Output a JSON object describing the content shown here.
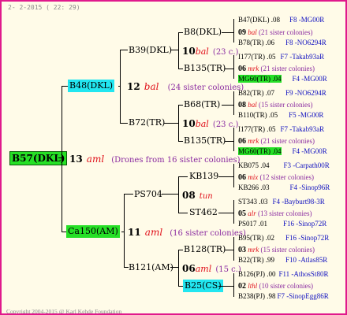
{
  "header": "2-  2-2015  ( 22: 29)",
  "footer": "Copyright 2004-2015 @ Karl Kehde Foundation",
  "root": {
    "name": "B57(DKL)"
  },
  "gen1": {
    "top": {
      "name": "B48(DKL)",
      "year": "12",
      "race": "bal",
      "siblings": "(24 sister colonies)"
    },
    "mid": {
      "year": "13",
      "race": "aml",
      "note": "(Drones from 16 sister colonies)"
    },
    "bot": {
      "name": "Ca150(AM)",
      "year": "11",
      "race": "aml",
      "siblings": "(16 sister colonies)"
    }
  },
  "gen2": [
    {
      "name": "B39(DKL)"
    },
    {
      "name": "B72(TR)"
    },
    {
      "name": "PS704"
    },
    {
      "name": "B121(AM)"
    }
  ],
  "gen3": [
    {
      "name": "B8(DKL)"
    },
    {
      "name": "B135(TR)"
    },
    {
      "name": "B68(TR)"
    },
    {
      "name": "B135(TR)"
    },
    {
      "name": "KB139"
    },
    {
      "name": "ST462"
    },
    {
      "name": "B128(TR)"
    },
    {
      "name": "B25(CS)"
    }
  ],
  "gen3_join": [
    {
      "year": "10",
      "race": "bal",
      "siblings": "(23 c.)"
    },
    {
      "year": "10",
      "race": "bal",
      "siblings": "(23 c.)"
    },
    {
      "year": "08",
      "race": "tun",
      "siblings": ""
    },
    {
      "year": "06",
      "race": "aml",
      "siblings": "(15 c.)"
    }
  ],
  "leaves": [
    {
      "top": "B47(DKL) .08",
      "top_right": "F8 -MG00R",
      "mid_year": "09",
      "mid_race": "bal",
      "mid_sib": "(21 sister colonies)",
      "bot": "B78(TR) .06",
      "bot_right": "F8 -NO6294R"
    },
    {
      "top": "I177(TR) .05",
      "top_right": "F7 -Takab93aR",
      "mid_year": "06",
      "mid_race": "mrk",
      "mid_sib": "(21 sister colonies)",
      "bot": "MG60(TR) .04",
      "bot_right": "F4 -MG00R"
    },
    {
      "top": "B82(TR) .07",
      "top_right": "F9 -NO6294R",
      "mid_year": "08",
      "mid_race": "bal",
      "mid_sib": "(15 sister colonies)",
      "bot": "B110(TR) .05",
      "bot_right": "F5 -MG00R"
    },
    {
      "top": "I177(TR) .05",
      "top_right": "F7 -Takab93aR",
      "mid_year": "06",
      "mid_race": "mrk",
      "mid_sib": "(21 sister colonies)",
      "bot": "MG60(TR) .04",
      "bot_right": "F4 -MG00R"
    },
    {
      "top": "KB075 .04",
      "top_right": "F3 -Carpath00R",
      "mid_year": "06",
      "mid_race": "mix",
      "mid_sib": "(12 sister colonies)",
      "bot": "KB266 .03",
      "bot_right": "F4 -Sinop96R"
    },
    {
      "top": "ST343 .03",
      "top_right": "F4 -Bayburt98-3R",
      "mid_year": "05",
      "mid_race": "alr",
      "mid_sib": "(13 sister colonies)",
      "bot": "PS017 .01",
      "bot_right": "F16 -Sinop72R"
    },
    {
      "top": "B95(TR) .02",
      "top_right": "F16 -Sinop72R",
      "mid_year": "03",
      "mid_race": "mrk",
      "mid_sib": "(15 sister colonies)",
      "bot": "B22(TR) .99",
      "bot_right": "F10 -Atlas85R"
    },
    {
      "top": "B126(PJ) .00",
      "top_right": "F11 -AthosSt80R",
      "mid_year": "02",
      "mid_race": "lthl",
      "mid_sib": "(10 sister colonies)",
      "bot": "B238(PJ) .98",
      "bot_right": "F7 -SinopEgg86R"
    }
  ]
}
